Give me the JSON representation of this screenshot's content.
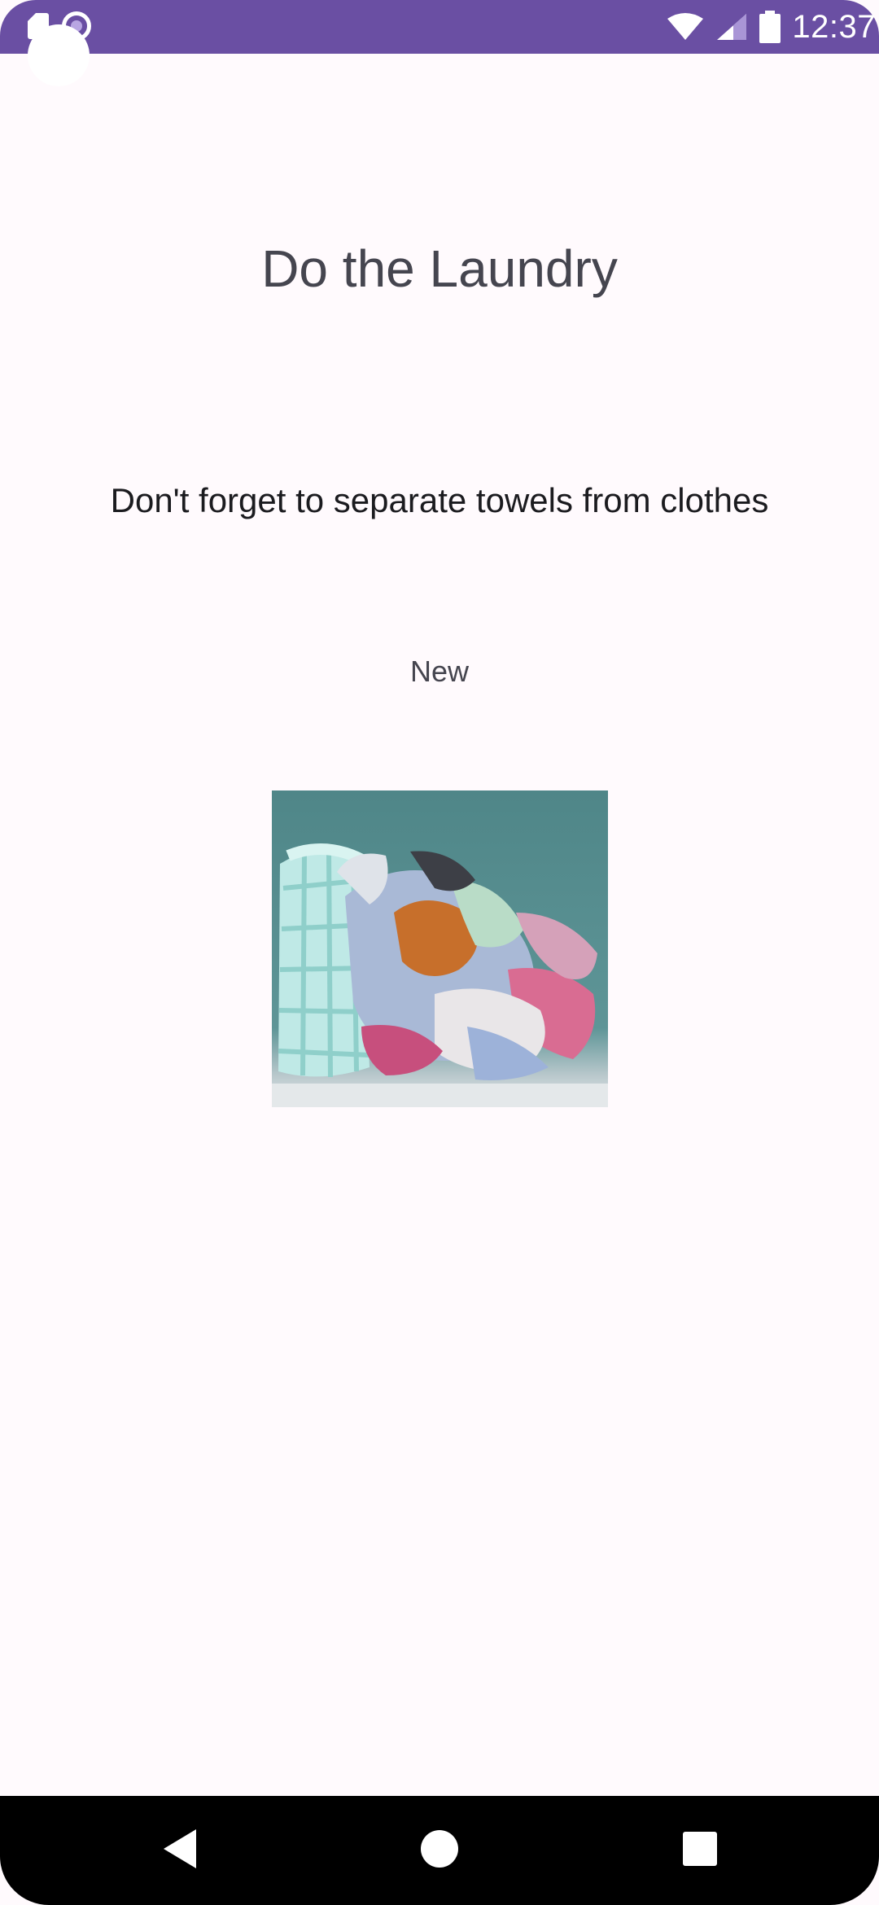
{
  "status_bar": {
    "time": "12:37",
    "icons": [
      "sd-card-icon",
      "sync-icon",
      "wifi-icon",
      "cellular-signal-icon",
      "battery-icon"
    ],
    "background": "#6a4fa3"
  },
  "task": {
    "title": "Do the Laundry",
    "description": "Don't forget to separate towels from clothes",
    "status": "New",
    "image": "laundry-basket-photo"
  },
  "navigation_bar": {
    "buttons": [
      "back-icon",
      "home-icon",
      "recents-icon"
    ]
  },
  "colors": {
    "accent": "#6a4fa3",
    "page_background": "#fffafd",
    "title_text": "#45454f",
    "body_text": "#1b1b1f"
  }
}
